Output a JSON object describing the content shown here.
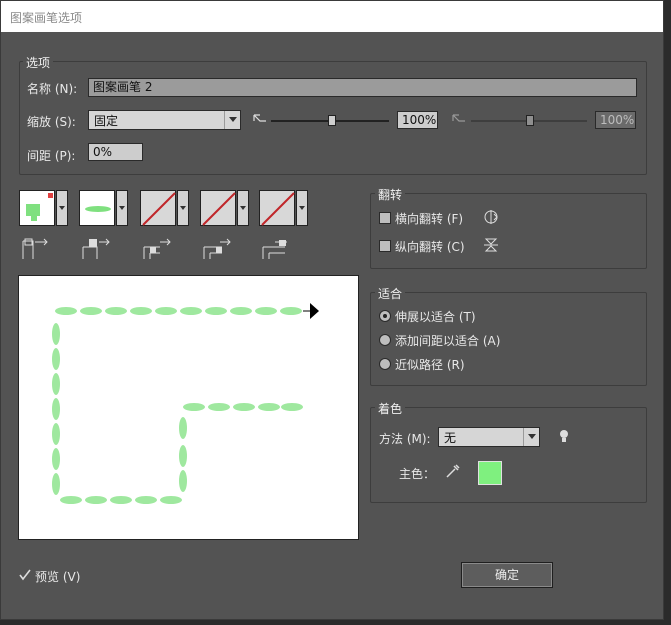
{
  "window": {
    "title": "图案画笔选项"
  },
  "options": {
    "group_label": "选项",
    "name_label": "名称 (N):",
    "name_value": "图案画笔 2",
    "scale_label": "缩放 (S):",
    "scale_select": "固定",
    "scale_value_1": "100%",
    "scale_value_2": "100%",
    "spacing_label": "间距 (P):",
    "spacing_value": "0%"
  },
  "tiles": [
    {
      "name": "side-tile"
    },
    {
      "name": "outer-corner-tile"
    },
    {
      "name": "inner-corner-tile"
    },
    {
      "name": "start-tile"
    },
    {
      "name": "end-tile"
    }
  ],
  "flip": {
    "group_label": "翻转",
    "horizontal": "横向翻转 (F)",
    "vertical": "纵向翻转 (C)"
  },
  "fit": {
    "group_label": "适合",
    "options": [
      "伸展以适合 (T)",
      "添加间距以适合 (A)",
      "近似路径 (R)"
    ],
    "selected": 0
  },
  "colorization": {
    "group_label": "着色",
    "method_label": "方法 (M):",
    "method_value": "无",
    "key_color_label": "主色：",
    "key_color": "#7ff07f"
  },
  "footer": {
    "preview_label": "预览 (V)",
    "preview_checked": true,
    "ok_label": "确定"
  }
}
